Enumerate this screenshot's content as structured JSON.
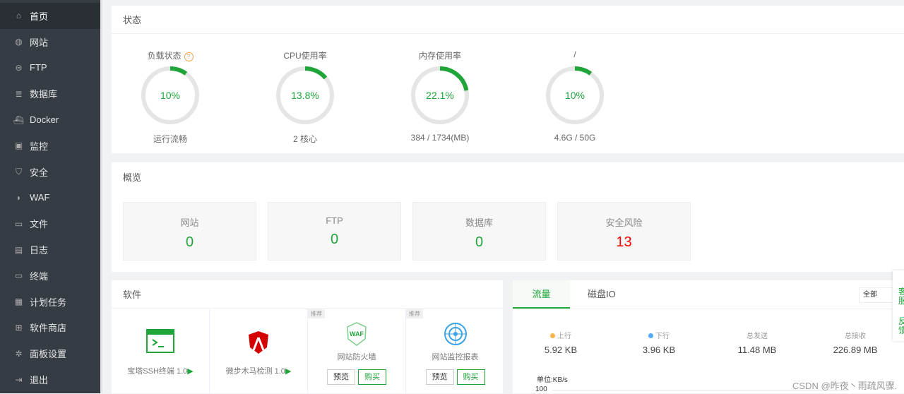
{
  "sidebar": {
    "items": [
      {
        "label": "首页",
        "icon": "home-icon"
      },
      {
        "label": "网站",
        "icon": "globe-icon"
      },
      {
        "label": "FTP",
        "icon": "ftp-icon"
      },
      {
        "label": "数据库",
        "icon": "database-icon"
      },
      {
        "label": "Docker",
        "icon": "docker-icon"
      },
      {
        "label": "监控",
        "icon": "monitor-icon"
      },
      {
        "label": "安全",
        "icon": "shield-icon"
      },
      {
        "label": "WAF",
        "icon": "waf-icon"
      },
      {
        "label": "文件",
        "icon": "folder-icon"
      },
      {
        "label": "日志",
        "icon": "log-icon"
      },
      {
        "label": "终端",
        "icon": "terminal-icon"
      },
      {
        "label": "计划任务",
        "icon": "calendar-icon"
      },
      {
        "label": "软件商店",
        "icon": "apps-icon"
      },
      {
        "label": "面板设置",
        "icon": "gear-icon"
      },
      {
        "label": "退出",
        "icon": "logout-icon"
      }
    ]
  },
  "status": {
    "title": "状态",
    "gauges": [
      {
        "label": "负载状态",
        "value": "10%",
        "percent": 10,
        "sub": "运行流畅"
      },
      {
        "label": "CPU使用率",
        "value": "13.8%",
        "percent": 13.8,
        "sub": "2 核心"
      },
      {
        "label": "内存使用率",
        "value": "22.1%",
        "percent": 22.1,
        "sub": "384 / 1734(MB)"
      },
      {
        "label": "/",
        "value": "10%",
        "percent": 10,
        "sub": "4.6G / 50G"
      }
    ],
    "help": "?"
  },
  "overview": {
    "title": "概览",
    "items": [
      {
        "label": "网站",
        "value": "0"
      },
      {
        "label": "FTP",
        "value": "0"
      },
      {
        "label": "数据库",
        "value": "0"
      },
      {
        "label": "安全风险",
        "value": "13"
      }
    ]
  },
  "software": {
    "title": "软件",
    "recommend": "推荐",
    "preview": "预览",
    "buy": "购买",
    "items": [
      {
        "name": "宝塔SSH终端 1.0"
      },
      {
        "name": "微步木马检测 1.0"
      },
      {
        "name": "网站防火墙"
      },
      {
        "name": "网站监控报表"
      }
    ]
  },
  "traffic": {
    "tabs": [
      "流量",
      "磁盘IO"
    ],
    "select": "全部",
    "stats": [
      {
        "label": "上行",
        "value": "5.92 KB"
      },
      {
        "label": "下行",
        "value": "3.96 KB"
      },
      {
        "label": "总发送",
        "value": "11.48 MB"
      },
      {
        "label": "总接收",
        "value": "226.89 MB"
      }
    ],
    "unit": "单位:KB/s",
    "ytick": "100"
  },
  "float": {
    "service": "客服",
    "feedback": "反馈"
  },
  "watermark": "CSDN @昨夜丶雨疏风骤.",
  "colors": {
    "accent": "#20a53a",
    "danger": "#ff0000",
    "up": "#f7b24a",
    "down": "#52a9ff"
  }
}
